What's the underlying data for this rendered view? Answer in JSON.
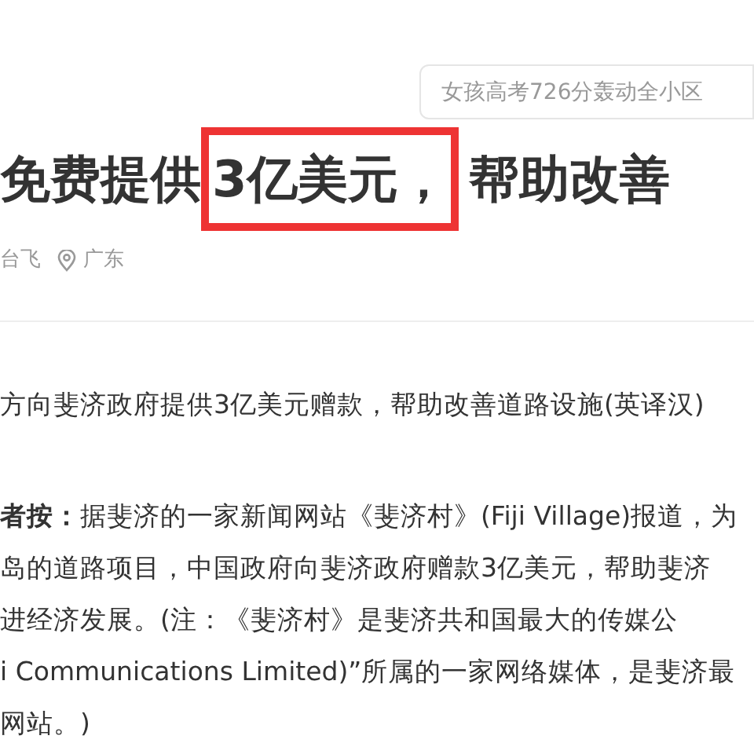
{
  "search": {
    "placeholder": "女孩高考726分轰动全小区"
  },
  "title": {
    "before": "免费提供",
    "highlighted": "3亿美元，",
    "after": "帮助改善"
  },
  "meta": {
    "author": "台飞",
    "location": "广东"
  },
  "paragraphs": [
    [
      "方向斐济政府提供3亿美元赠款，帮助改善道路设施(英译汉)"
    ],
    [
      "**者按：**据斐济的一家新闻网站《斐济村》(Fiji Village)报道，为",
      "岛的道路项目，中国政府向斐济政府赠款3亿美元，帮助斐济",
      "进经济发展。(注：《斐济村》是斐济共和国最大的传媒公",
      "i Communications Limited)”所属的一家网络媒体，是斐济最",
      "网站。)"
    ]
  ]
}
